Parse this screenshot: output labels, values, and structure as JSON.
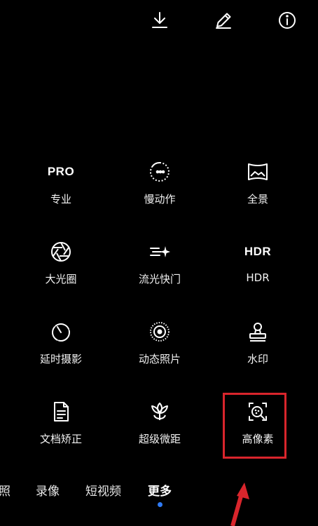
{
  "top_bar": {
    "icons": [
      "download-icon",
      "edit-icon",
      "info-icon"
    ]
  },
  "modes": [
    {
      "icon_text": "PRO",
      "label": "专业",
      "icon": "pro-text-icon"
    },
    {
      "icon_text": "",
      "label": "慢动作",
      "icon": "slow-motion-icon"
    },
    {
      "icon_text": "",
      "label": "全景",
      "icon": "panorama-icon"
    },
    {
      "icon_text": "",
      "label": "大光圈",
      "icon": "aperture-icon"
    },
    {
      "icon_text": "",
      "label": "流光快门",
      "icon": "light-painting-icon"
    },
    {
      "icon_text": "HDR",
      "label": "HDR",
      "icon": "hdr-text-icon"
    },
    {
      "icon_text": "",
      "label": "延时摄影",
      "icon": "timelapse-icon"
    },
    {
      "icon_text": "",
      "label": "动态照片",
      "icon": "moving-picture-icon"
    },
    {
      "icon_text": "",
      "label": "水印",
      "icon": "watermark-stamp-icon"
    },
    {
      "icon_text": "",
      "label": "文档矫正",
      "icon": "document-icon"
    },
    {
      "icon_text": "",
      "label": "超级微距",
      "icon": "flower-macro-icon"
    },
    {
      "icon_text": "",
      "label": "高像素",
      "icon": "high-resolution-icon"
    }
  ],
  "tabs": [
    "照",
    "录像",
    "短视频",
    "更多"
  ],
  "active_tab": "更多",
  "colors": {
    "background": "#000000",
    "highlight": "#d9252c",
    "active_dot": "#2f7bf5"
  }
}
